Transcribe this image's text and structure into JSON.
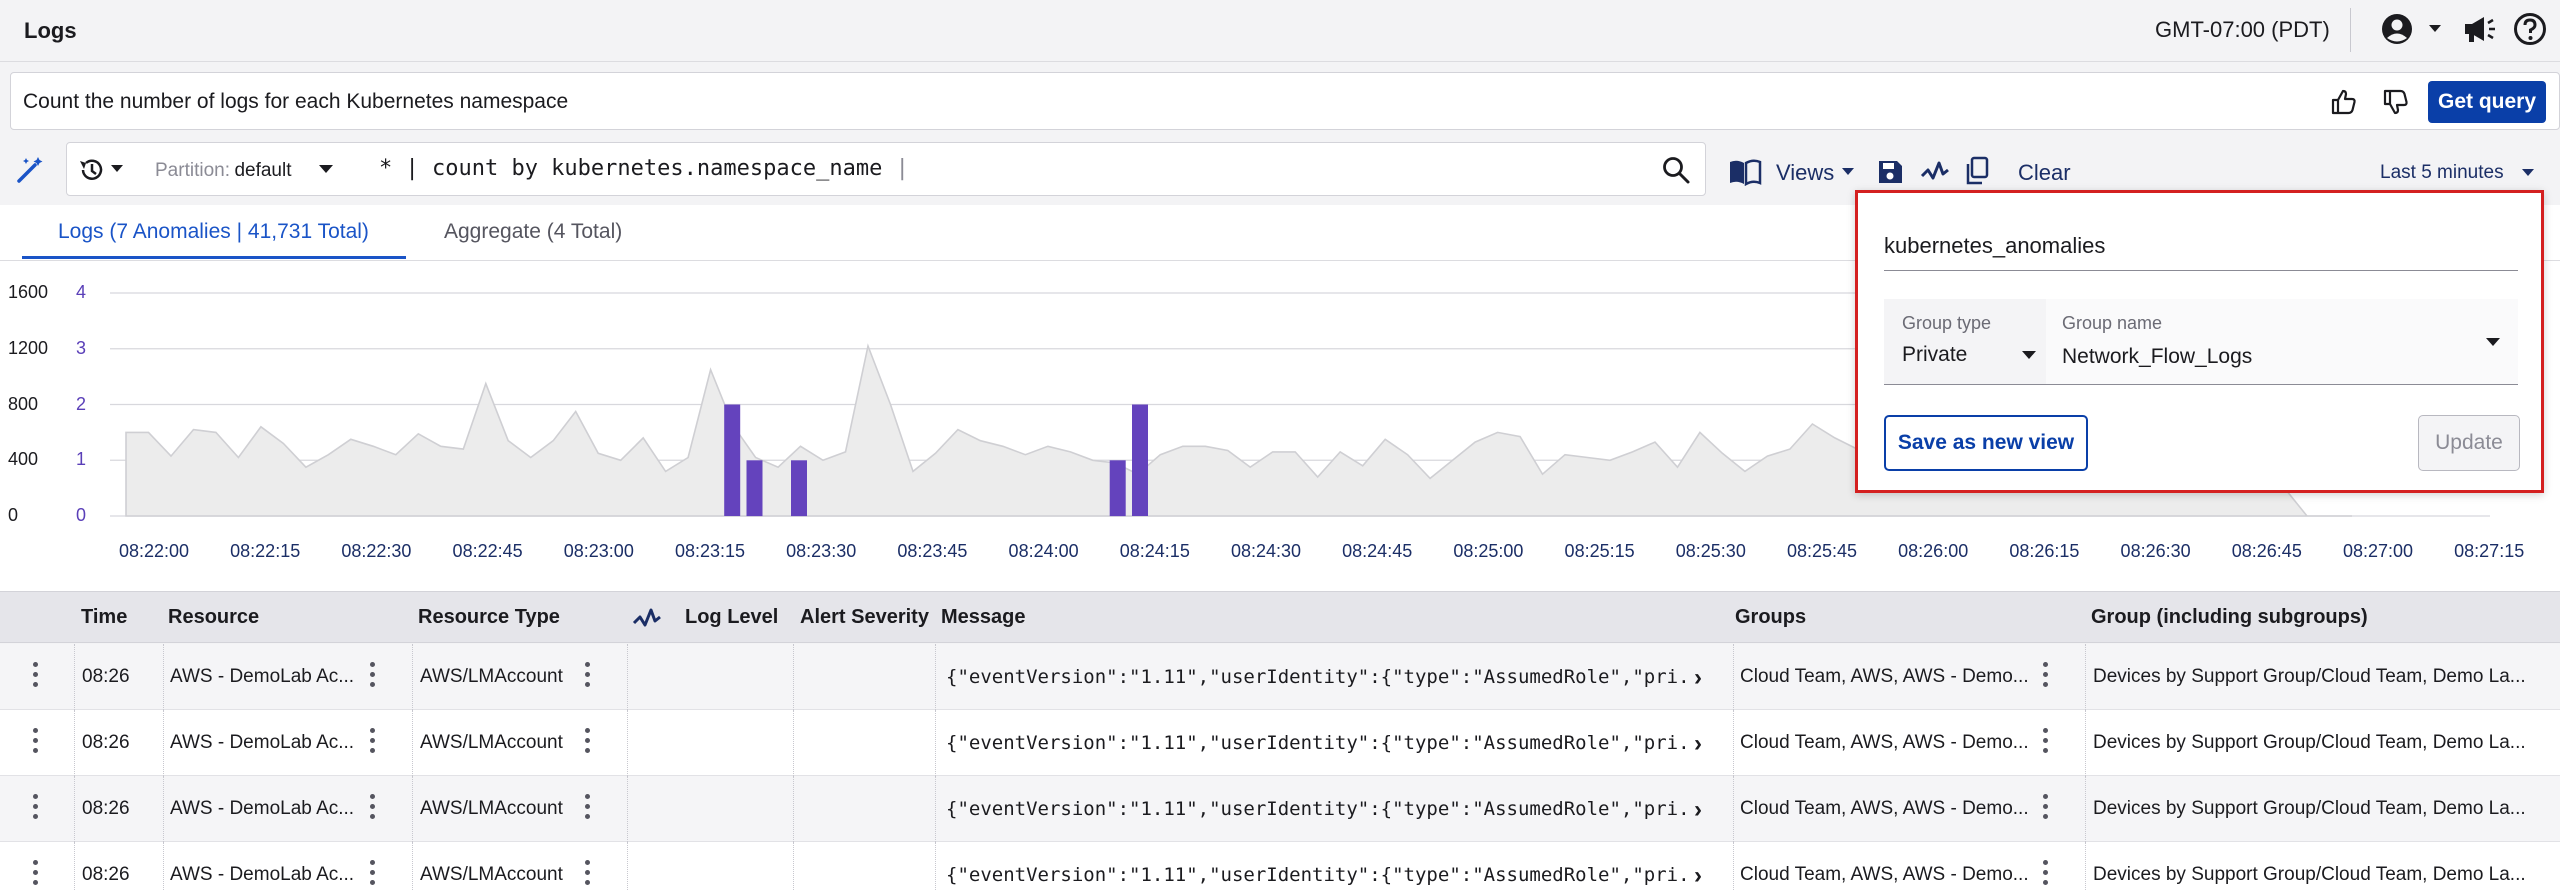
{
  "header": {
    "title": "Logs",
    "timezone": "GMT-07:00 (PDT)",
    "icons": [
      "user-circle-icon",
      "chevron-down-icon",
      "megaphone-icon",
      "help-icon"
    ]
  },
  "nl_query": {
    "text": "Count the number of logs for each Kubernetes namespace",
    "get_query_label": "Get query"
  },
  "query_bar": {
    "partition_label": "Partition:",
    "partition_value": "default",
    "query": "* | count by kubernetes.namespace_name",
    "views_label": "Views",
    "clear_label": "Clear",
    "time_range": "Last 5 minutes"
  },
  "tabs": [
    {
      "label": "Logs (7 Anomalies | 41,731 Total)",
      "active": true
    },
    {
      "label": "Aggregate (4 Total)",
      "active": false
    }
  ],
  "chart_data": {
    "type": "area",
    "left_axis_ticks": [
      "0",
      "400",
      "800",
      "1200",
      "1600"
    ],
    "right_axis_ticks": [
      "0",
      "1",
      "2",
      "3",
      "4"
    ],
    "x_ticks": [
      "08:22:00",
      "08:22:15",
      "08:22:30",
      "08:22:45",
      "08:23:00",
      "08:23:15",
      "08:23:30",
      "08:23:45",
      "08:24:00",
      "08:24:15",
      "08:24:30",
      "08:24:45",
      "08:25:00",
      "08:25:15",
      "08:25:30",
      "08:25:45",
      "08:26:00",
      "08:26:15",
      "08:26:30",
      "08:26:45",
      "08:27:00",
      "08:27:15"
    ],
    "ylim_left": [
      0,
      1600
    ],
    "ylim_right": [
      0,
      4
    ],
    "series": [
      {
        "kind": "area",
        "values": [
          600,
          600,
          430,
          620,
          600,
          420,
          640,
          520,
          350,
          440,
          550,
          500,
          440,
          590,
          500,
          480,
          950,
          540,
          420,
          540,
          750,
          450,
          400,
          560,
          320,
          420,
          1050,
          650,
          420,
          350,
          500,
          400,
          460,
          1220,
          800,
          320,
          450,
          620,
          540,
          500,
          440,
          500,
          460,
          400,
          380,
          300,
          440,
          500,
          500,
          470,
          350,
          460,
          460,
          280,
          460,
          360,
          550,
          440,
          270,
          400,
          530,
          600,
          570,
          300,
          440,
          420,
          400,
          460,
          530,
          350,
          600,
          450,
          320,
          430,
          480,
          660,
          560,
          480,
          420,
          470,
          430,
          420,
          620,
          540,
          480,
          500,
          430,
          400,
          500,
          470,
          430,
          420,
          380,
          400,
          300,
          460,
          200,
          0,
          0,
          0
        ]
      },
      {
        "kind": "anomaly-bars",
        "color": "#6443bd",
        "points": [
          {
            "x": "08:23:18",
            "value": 2
          },
          {
            "x": "08:23:21",
            "value": 1
          },
          {
            "x": "08:23:27",
            "value": 1
          },
          {
            "x": "08:24:10",
            "value": 1
          },
          {
            "x": "08:24:13",
            "value": 2
          }
        ]
      }
    ]
  },
  "table": {
    "columns": [
      "Time",
      "Resource",
      "Resource Type",
      "Log Level",
      "Alert Severity",
      "Message",
      "Groups",
      "Group (including subgroups)"
    ],
    "rows": [
      {
        "time": "08:26",
        "resource": "AWS - DemoLab Ac...",
        "resource_type": "AWS/LMAccount",
        "log_level": "",
        "alert_severity": "",
        "message": "{\"eventVersion\":\"1.11\",\"userIdentity\":{\"type\":\"AssumedRole\",\"pri...",
        "groups": "Cloud Team, AWS, AWS - Demo...",
        "group_sub": "Devices by Support Group/Cloud Team, Demo La..."
      },
      {
        "time": "08:26",
        "resource": "AWS - DemoLab Ac...",
        "resource_type": "AWS/LMAccount",
        "log_level": "",
        "alert_severity": "",
        "message": "{\"eventVersion\":\"1.11\",\"userIdentity\":{\"type\":\"AssumedRole\",\"pri...",
        "groups": "Cloud Team, AWS, AWS - Demo...",
        "group_sub": "Devices by Support Group/Cloud Team, Demo La..."
      },
      {
        "time": "08:26",
        "resource": "AWS - DemoLab Ac...",
        "resource_type": "AWS/LMAccount",
        "log_level": "",
        "alert_severity": "",
        "message": "{\"eventVersion\":\"1.11\",\"userIdentity\":{\"type\":\"AssumedRole\",\"pri...",
        "groups": "Cloud Team, AWS, AWS - Demo...",
        "group_sub": "Devices by Support Group/Cloud Team, Demo La..."
      },
      {
        "time": "08:26",
        "resource": "AWS - DemoLab Ac...",
        "resource_type": "AWS/LMAccount",
        "log_level": "",
        "alert_severity": "",
        "message": "{\"eventVersion\":\"1.11\",\"userIdentity\":{\"type\":\"AssumedRole\",\"pri...",
        "groups": "Cloud Team, AWS, AWS - Demo...",
        "group_sub": "Devices by Support Group/Cloud Team, Demo La..."
      }
    ]
  },
  "save_view_popup": {
    "view_name": "kubernetes_anomalies",
    "group_type_label": "Group type",
    "group_type_value": "Private",
    "group_name_label": "Group name",
    "group_name_value": "Network_Flow_Logs",
    "save_new_label": "Save as new view",
    "update_label": "Update"
  },
  "colors": {
    "accent": "#0a3fa8",
    "tab_active": "#1a54c7",
    "anomaly": "#6443bd",
    "area_fill": "#ececec",
    "highlight_border": "#d42020"
  }
}
